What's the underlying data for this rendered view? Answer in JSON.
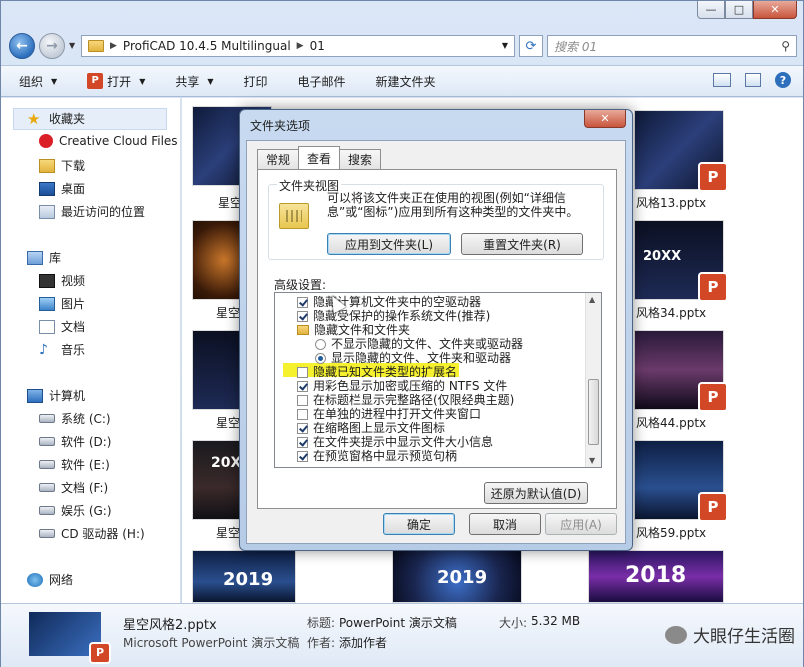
{
  "window": {
    "caption_buttons": {
      "minimize": "—",
      "maximize": "□",
      "close": "✕"
    }
  },
  "address": {
    "crumbs": [
      "ProfiCAD 10.4.5 Multilingual",
      "01"
    ],
    "search_placeholder": "搜索 01"
  },
  "toolbar": {
    "items": [
      {
        "label": "组织",
        "has_arrow": true
      },
      {
        "label": "打开",
        "has_arrow": true,
        "icon": "P"
      },
      {
        "label": "共享",
        "has_arrow": true
      },
      {
        "label": "打印"
      },
      {
        "label": "电子邮件"
      },
      {
        "label": "新建文件夹"
      }
    ],
    "help": "?"
  },
  "navpane": {
    "favorites": {
      "label": "收藏夹",
      "items": [
        "Creative Cloud Files",
        "下载",
        "桌面",
        "最近访问的位置"
      ]
    },
    "libraries": {
      "label": "库",
      "items": [
        "视频",
        "图片",
        "文档",
        "音乐"
      ]
    },
    "computer": {
      "label": "计算机",
      "items": [
        "系统 (C:)",
        "软件 (D:)",
        "软件 (E:)",
        "文档 (F:)",
        "娱乐 (G:)",
        "CD 驱动器 (H:)"
      ]
    },
    "network": {
      "label": "网络"
    }
  },
  "content": {
    "left_labels": [
      "星空",
      "星空",
      "星空",
      "星空",
      "星空"
    ],
    "right_labels": [
      "风格13.pptx",
      "风格34.pptx",
      "风格44.pptx",
      "风格59.pptx"
    ],
    "thumb_texts": {
      "t_20xx_a": "20XX",
      "t_20xx_b": "20XX",
      "t_2019_a": "2019",
      "t_2019_b": "2019",
      "t_2018": "2018"
    },
    "ppt_badge": "P"
  },
  "details": {
    "name": "星空风格2.pptx",
    "type": "Microsoft PowerPoint 演示文稿",
    "title_label": "标题:",
    "title_value": "PowerPoint 演示文稿",
    "author_label": "作者:",
    "author_value": "添加作者",
    "size_label": "大小:",
    "size_value": "5.32 MB",
    "watermark": "大眼仔生活圈"
  },
  "dialog": {
    "title": "文件夹选项",
    "close": "✕",
    "tabs": [
      "常规",
      "查看",
      "搜索"
    ],
    "active_tab": 1,
    "folder_view": {
      "title": "文件夹视图",
      "text": "可以将该文件夹正在使用的视图(例如“详细信息”或“图标”)应用到所有这种类型的文件夹中。",
      "apply_button": "应用到文件夹(L)",
      "reset_button": "重置文件夹(R)"
    },
    "advanced_label": "高级设置:",
    "advanced_items": [
      {
        "kind": "check",
        "checked": true,
        "label": "隐藏计算机文件夹中的空驱动器"
      },
      {
        "kind": "check",
        "checked": true,
        "label": "隐藏受保护的操作系统文件(推荐)"
      },
      {
        "kind": "folder",
        "label": "隐藏文件和文件夹"
      },
      {
        "kind": "radio",
        "checked": false,
        "label": "不显示隐藏的文件、文件夹或驱动器"
      },
      {
        "kind": "radio",
        "checked": true,
        "label": "显示隐藏的文件、文件夹和驱动器"
      },
      {
        "kind": "check",
        "checked": false,
        "label": "隐藏已知文件类型的扩展名"
      },
      {
        "kind": "check",
        "checked": true,
        "label": "用彩色显示加密或压缩的 NTFS 文件"
      },
      {
        "kind": "check",
        "checked": false,
        "label": "在标题栏显示完整路径(仅限经典主题)"
      },
      {
        "kind": "check",
        "checked": false,
        "label": "在单独的进程中打开文件夹窗口"
      },
      {
        "kind": "check",
        "checked": true,
        "label": "在缩略图上显示文件图标"
      },
      {
        "kind": "check",
        "checked": true,
        "label": "在文件夹提示中显示文件大小信息"
      },
      {
        "kind": "check",
        "checked": true,
        "label": "在预览窗格中显示预览句柄"
      }
    ],
    "restore_defaults": "还原为默认值(D)",
    "ok": "确定",
    "cancel": "取消",
    "apply": "应用(A)"
  }
}
